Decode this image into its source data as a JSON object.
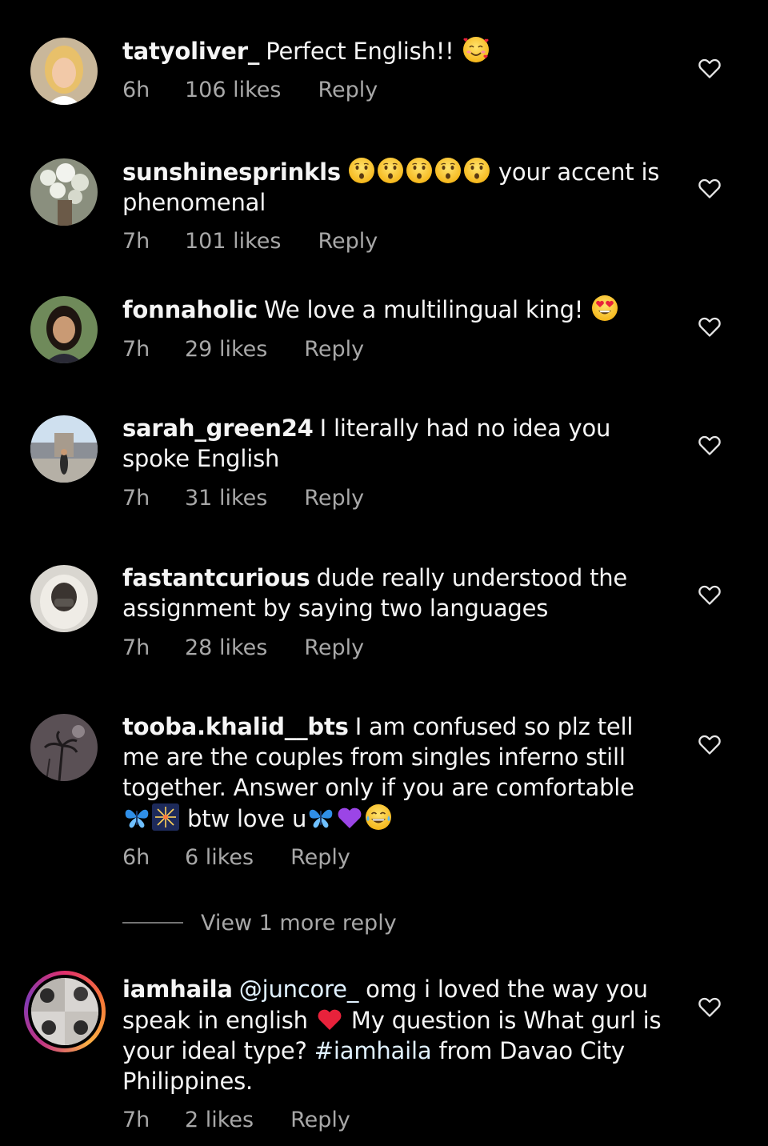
{
  "comments": [
    {
      "username": "tatyoliver_",
      "text": "Perfect English!!",
      "time": "6h",
      "likes": "106 likes",
      "reply": "Reply"
    },
    {
      "username": "sunshinesprinkls",
      "text": "your accent is phenomenal",
      "time": "7h",
      "likes": "101 likes",
      "reply": "Reply"
    },
    {
      "username": "fonnaholic",
      "text": "We love a multilingual king!",
      "time": "7h",
      "likes": "29 likes",
      "reply": "Reply"
    },
    {
      "username": "sarah_green24",
      "text": "I literally had no idea you spoke English",
      "time": "7h",
      "likes": "31 likes",
      "reply": "Reply"
    },
    {
      "username": "fastantcurious",
      "text": "dude really understood the assignment by saying two languages",
      "time": "7h",
      "likes": "28 likes",
      "reply": "Reply"
    },
    {
      "username": "tooba.khalid__bts",
      "text": "I am confused so plz tell me are the couples from singles inferno still together. Answer only if you are comfortable",
      "text_tail": "btw love u",
      "time": "6h",
      "likes": "6 likes",
      "reply": "Reply"
    },
    {
      "username": "iamhaila",
      "mention": "@juncore_",
      "text_a": "omg i loved the way you speak in english",
      "text_b": "My question is What gurl is your ideal type?",
      "hashtag": "#iamhaila",
      "text_c": "from Davao City Philippines.",
      "time": "7h",
      "likes": "2 likes",
      "reply": "Reply"
    }
  ],
  "view_more_replies": "View 1 more reply",
  "icons": {
    "like": "heart-outline-icon",
    "emojis": [
      "smiling-face-with-hearts",
      "hushed-face",
      "heart-eyes",
      "butterfly",
      "fireworks",
      "purple-heart",
      "tears-of-joy",
      "red-heart"
    ]
  },
  "colors": {
    "background": "#000000",
    "primary_text": "#f5f5f5",
    "secondary_text": "#a8a8a8",
    "mention": "#e0f1ff"
  }
}
